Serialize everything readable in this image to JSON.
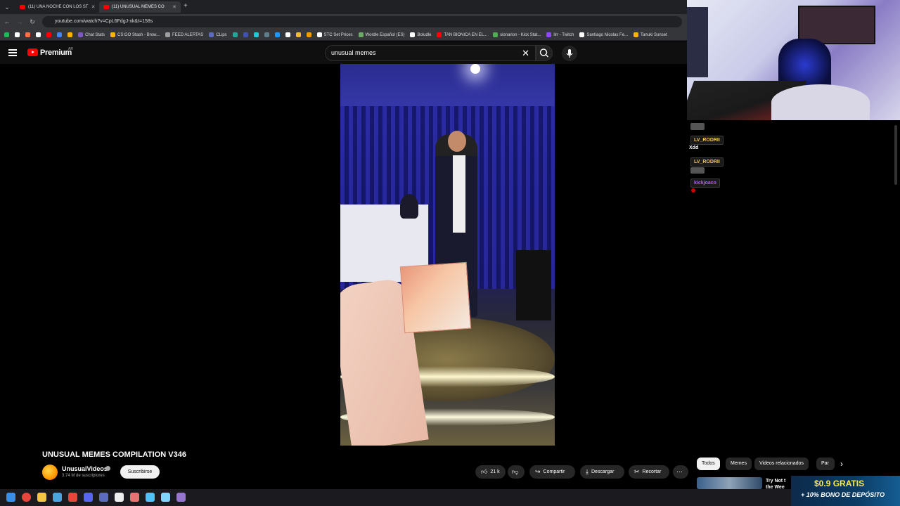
{
  "browser": {
    "tabs": [
      {
        "label": "(11) UNA NOCHE CON LOS ST"
      },
      {
        "label": "(11) UNUSUAL MEMES CO"
      }
    ],
    "url": "youtube.com/watch?v=CpL6FdgJ-xk&t=158s",
    "bookmarks": [
      {
        "label": "",
        "color": "#1db954"
      },
      {
        "label": "",
        "color": "#ffffff"
      },
      {
        "label": "",
        "color": "#ff7043"
      },
      {
        "label": "",
        "color": "#ffffff"
      },
      {
        "label": "",
        "color": "#ff0000"
      },
      {
        "label": "",
        "color": "#4285f4"
      },
      {
        "label": "",
        "color": "#ffb300"
      },
      {
        "label": "Chat Stats",
        "color": "#7e57c2"
      },
      {
        "label": "CS:GO Stash - Brow...",
        "color": "#ffb300"
      },
      {
        "label": "FEED ALERTAS",
        "color": "#9e9e9e"
      },
      {
        "label": "CLips",
        "color": "#5c6bc0"
      },
      {
        "label": "",
        "color": "#26a69a"
      },
      {
        "label": "",
        "color": "#3f51b5"
      },
      {
        "label": "",
        "color": "#26c6da"
      },
      {
        "label": "",
        "color": "#607d8b"
      },
      {
        "label": "",
        "color": "#2196f3"
      },
      {
        "label": "",
        "color": "#ffffff"
      },
      {
        "label": "",
        "color": "#f3ba2f"
      },
      {
        "label": "",
        "color": "#ff9800"
      },
      {
        "label": "STC Set Prices",
        "color": "#ffffff"
      },
      {
        "label": "Wordle Español (ES)",
        "color": "#6aaa64"
      },
      {
        "label": "Boludle",
        "color": "#ffffff"
      },
      {
        "label": "TAN BIONICA EN EL...",
        "color": "#ff0000"
      },
      {
        "label": "sionarion - Kick Stat...",
        "color": "#4caf50"
      },
      {
        "label": "lirr - Twitch",
        "color": "#9146ff"
      },
      {
        "label": "Santiago Nicolas Fe...",
        "color": "#ffffff"
      },
      {
        "label": "Tanuki Sunset",
        "color": "#ffb300"
      }
    ]
  },
  "youtube": {
    "logo_text": "Premium",
    "country": "AR",
    "search_value": "unusual memes",
    "video_title": "UNUSUAL MEMES COMPILATION V346",
    "channel_name": "UnusualVideos",
    "subscribers": "3.74 M de suscriptores",
    "subscribe_label": "Suscribirse",
    "likes": "21 k",
    "share_label": "Compartir",
    "download_label": "Descargar",
    "clip_label": "Recortar",
    "chips": [
      "Todos",
      "Memes",
      "Videos relacionados",
      "Par"
    ],
    "rec_title_1": "Try Not t",
    "rec_title_2": "the Wee"
  },
  "chat": [
    {
      "user": "LV_RODRII",
      "color": "#f5c35a",
      "message": "Xdd"
    },
    {
      "user": "LV_RODRII",
      "color": "#f5c35a",
      "message": ""
    },
    {
      "user": "kickjoaco",
      "color": "#b05cff",
      "message": ""
    }
  ],
  "promo": {
    "line1": "$0.9 GRATIS",
    "line2": "+ 10% BONO DE DEPÓSITO"
  },
  "taskbar": {
    "icons": [
      "windows-icon",
      "chrome-icon",
      "explorer-icon",
      "steam-icon",
      "chrome-alt-icon",
      "discord-icon",
      "monitor-icon",
      "terminal-icon",
      "calculator-icon",
      "settings-icon",
      "network-icon",
      "app-icon"
    ]
  }
}
